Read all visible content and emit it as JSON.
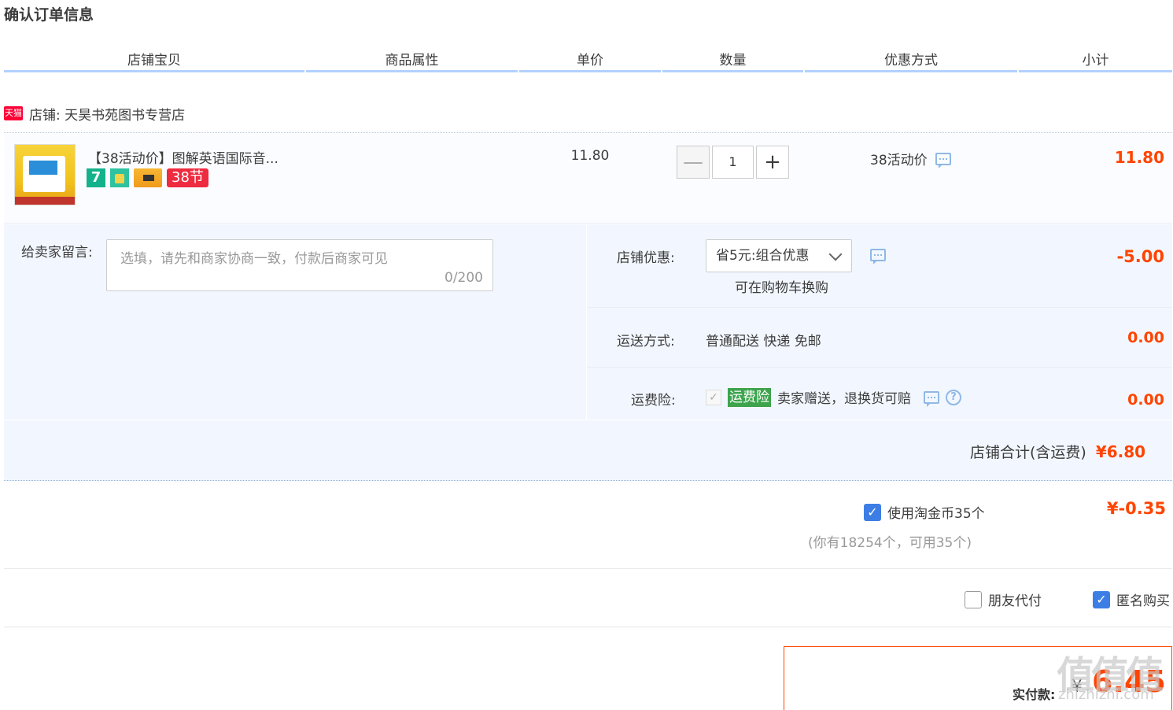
{
  "page": {
    "title": "确认订单信息"
  },
  "columns": [
    "店铺宝贝",
    "商品属性",
    "单价",
    "数量",
    "优惠方式",
    "小计"
  ],
  "store": {
    "badge": "天猫",
    "name": "店铺: 天昊书苑图书专营店"
  },
  "item": {
    "title": "【38活动价】图解英语国际音...",
    "badge_7": "7",
    "badge_38": "38节",
    "price": "11.80",
    "quantity": "1",
    "qty_minus": "—",
    "qty_plus": "+",
    "promo": "38活动价",
    "subtotal": "11.80"
  },
  "message": {
    "label": "给卖家留言:",
    "placeholder": "选填，请先和商家协商一致，付款后商家可见",
    "count": "0/200"
  },
  "store_discount": {
    "label": "店铺优惠:",
    "selected": "省5元:组合优惠",
    "note": "可在购物车换购",
    "amount": "-5.00"
  },
  "shipping": {
    "label": "运送方式:",
    "value": "普通配送 快递 免邮",
    "amount": "0.00"
  },
  "insurance": {
    "label": "运费险:",
    "check": "✓",
    "tag": "运费险",
    "desc": "卖家赠送，退换货可赔",
    "help": "?",
    "amount": "0.00"
  },
  "store_total": {
    "label": "店铺合计(含运费)",
    "amount": "¥6.80"
  },
  "coins": {
    "check": "✓",
    "label": "使用淘金币35个",
    "amount": "¥-0.35",
    "note": "(你有18254个，可用35个)"
  },
  "options": {
    "friend_pay": "朋友代付",
    "anon_check": "✓",
    "anonymous": "匿名购买"
  },
  "payment": {
    "label": "实付款:",
    "yen": "¥",
    "amount": "6.45"
  },
  "watermark": {
    "text": "值值值",
    "sub": "zhizhizhi.com"
  },
  "colors": {
    "price_red": "#ff4400",
    "accent_blue": "#3d7ee5",
    "band": "#f2f7ff"
  }
}
